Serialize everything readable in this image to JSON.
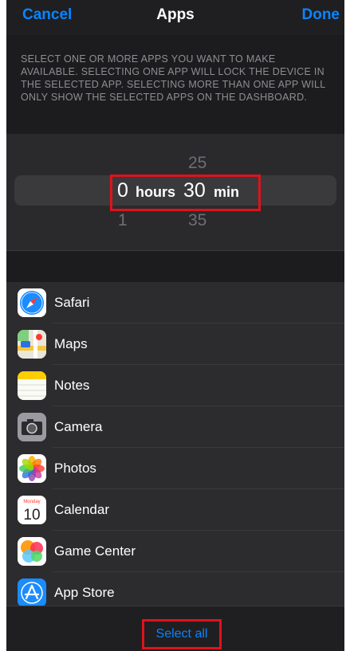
{
  "nav": {
    "cancel": "Cancel",
    "title": "Apps",
    "done": "Done"
  },
  "instructions": "SELECT ONE OR MORE APPS YOU WANT TO MAKE AVAILABLE. SELECTING ONE APP WILL LOCK THE DEVICE IN THE SELECTED APP. SELECTING MORE THAN ONE APP WILL ONLY SHOW THE SELECTED APPS ON THE DASHBOARD.",
  "picker": {
    "above": {
      "hours": "",
      "minutes": "25"
    },
    "selected": {
      "hours": "0",
      "hours_unit": "hours",
      "minutes": "30",
      "minutes_unit": "min"
    },
    "below": {
      "hours": "1",
      "minutes": "35"
    }
  },
  "apps": [
    {
      "label": "Safari",
      "icon": "safari-icon"
    },
    {
      "label": "Maps",
      "icon": "maps-icon"
    },
    {
      "label": "Notes",
      "icon": "notes-icon"
    },
    {
      "label": "Camera",
      "icon": "camera-icon"
    },
    {
      "label": "Photos",
      "icon": "photos-icon"
    },
    {
      "label": "Calendar",
      "icon": "calendar-icon",
      "icon_text": {
        "month": "Monday",
        "day": "10"
      }
    },
    {
      "label": "Game Center",
      "icon": "game-center-icon"
    },
    {
      "label": "App Store",
      "icon": "app-store-icon"
    }
  ],
  "footer": {
    "select_all": "Select all"
  },
  "colors": {
    "accent": "#0a84ff",
    "highlight": "#e0121b",
    "background": "#1c1c1e"
  }
}
